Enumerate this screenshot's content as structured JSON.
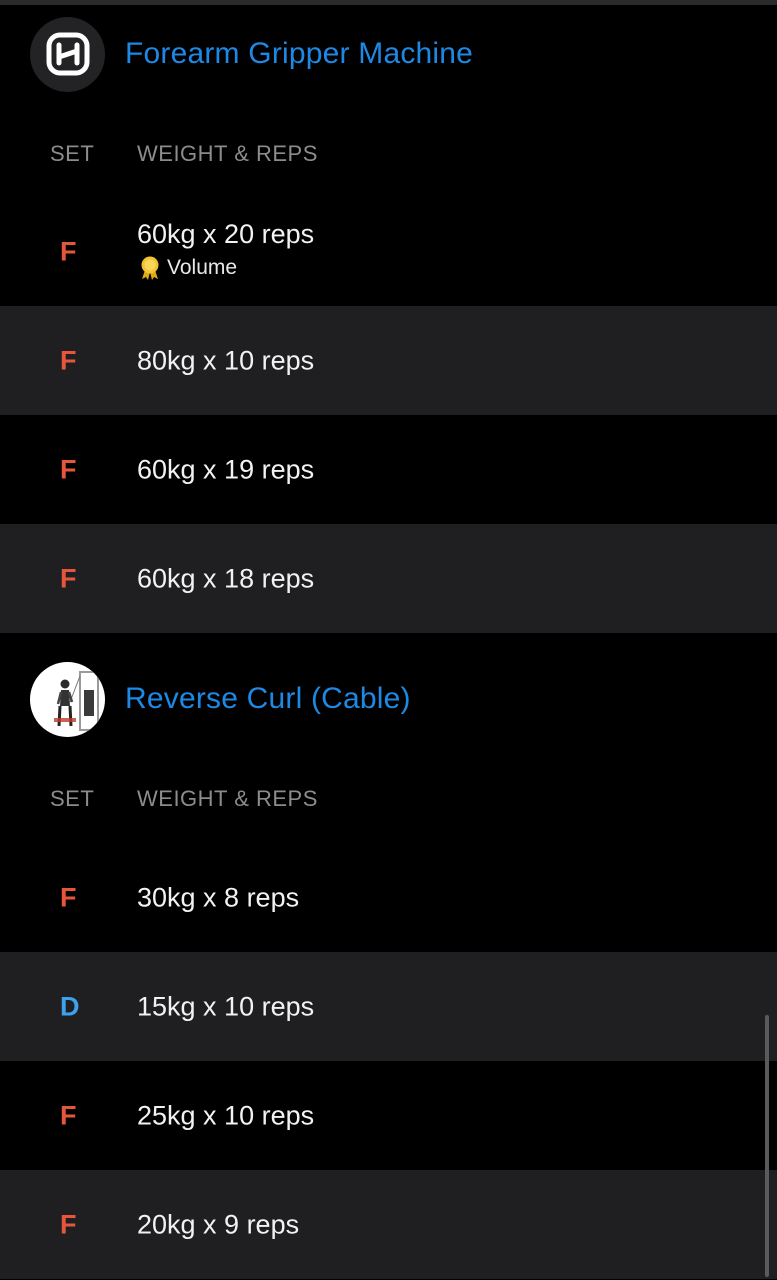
{
  "theme": {
    "accent": "#1e88e5",
    "failure_color": "#e8553d",
    "drop_color": "#3ea1ee",
    "row_alt_bg": "#1f1f21"
  },
  "exercises": [
    {
      "title": "Forearm Gripper Machine",
      "icon": "hevy-logo-icon",
      "columns": {
        "set": "SET",
        "weight_reps": "WEIGHT & REPS"
      },
      "sets": [
        {
          "type": "F",
          "value": "60kg x 20 reps",
          "record": {
            "icon": "medal-icon",
            "label": "Volume"
          }
        },
        {
          "type": "F",
          "value": "80kg x 10 reps"
        },
        {
          "type": "F",
          "value": "60kg x 19 reps"
        },
        {
          "type": "F",
          "value": "60kg x 18 reps"
        }
      ]
    },
    {
      "title": "Reverse Curl (Cable)",
      "icon": "cable-machine-person-icon",
      "columns": {
        "set": "SET",
        "weight_reps": "WEIGHT & REPS"
      },
      "sets": [
        {
          "type": "F",
          "value": "30kg x 8 reps"
        },
        {
          "type": "D",
          "value": "15kg x 10 reps"
        },
        {
          "type": "F",
          "value": "25kg x 10 reps"
        },
        {
          "type": "F",
          "value": "20kg x 9 reps"
        }
      ]
    }
  ]
}
